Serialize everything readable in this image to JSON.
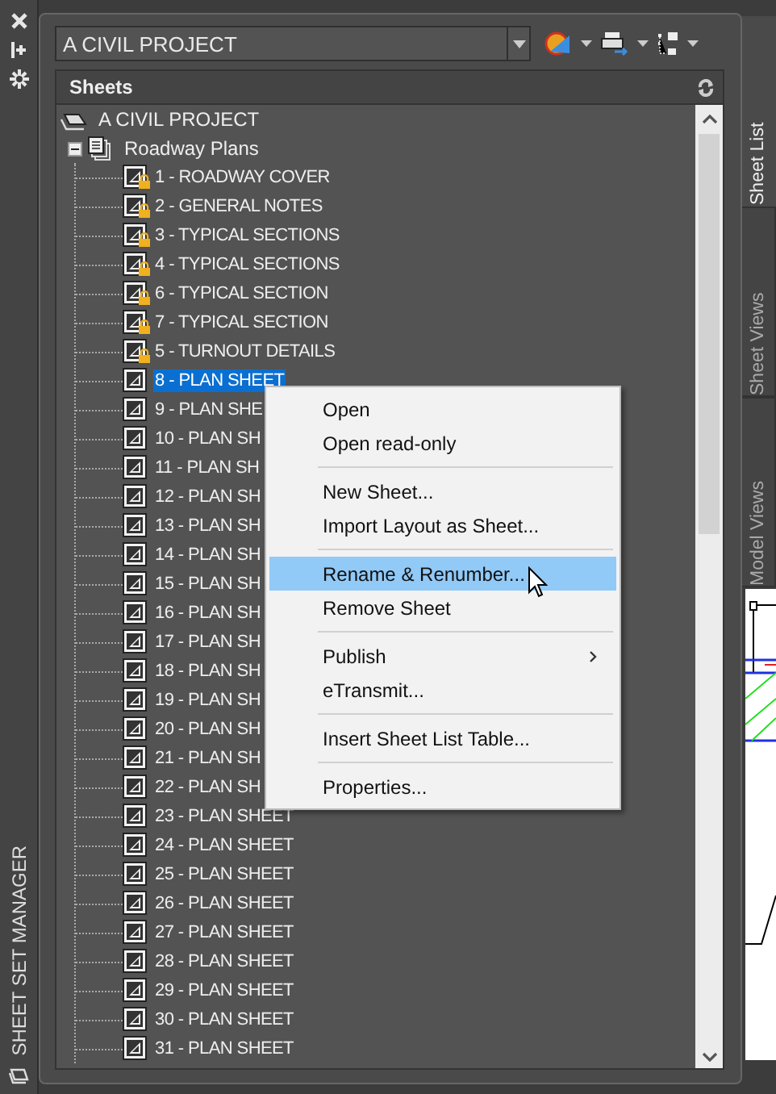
{
  "palette_title": "SHEET SET MANAGER",
  "sheet_set_combo": {
    "value": "A CIVIL PROJECT"
  },
  "panel_title": "Sheets",
  "side_tabs": [
    {
      "label": "Sheet List",
      "selected": true
    },
    {
      "label": "Sheet Views",
      "selected": false
    },
    {
      "label": "Model Views",
      "selected": false
    }
  ],
  "tree": {
    "label": "A CIVIL PROJECT",
    "children": [
      {
        "label": "Roadway Plans",
        "expanded": true,
        "children": [
          {
            "label": "1 - ROADWAY COVER",
            "locked": true,
            "selected": false
          },
          {
            "label": "2 - GENERAL NOTES",
            "locked": true,
            "selected": false
          },
          {
            "label": "3 - TYPICAL SECTIONS",
            "locked": true,
            "selected": false
          },
          {
            "label": "4 - TYPICAL SECTIONS",
            "locked": true,
            "selected": false
          },
          {
            "label": "6 - TYPICAL SECTION",
            "locked": true,
            "selected": false
          },
          {
            "label": "7 - TYPICAL SECTION",
            "locked": true,
            "selected": false
          },
          {
            "label": "5 - TURNOUT DETAILS",
            "locked": true,
            "selected": false
          },
          {
            "label": "8 - PLAN SHEET",
            "locked": false,
            "selected": true
          },
          {
            "label": "9 - PLAN SHE",
            "locked": false,
            "selected": false
          },
          {
            "label": "10 - PLAN SH",
            "locked": false,
            "selected": false
          },
          {
            "label": "11 - PLAN SH",
            "locked": false,
            "selected": false
          },
          {
            "label": "12 - PLAN SH",
            "locked": false,
            "selected": false
          },
          {
            "label": "13 - PLAN SH",
            "locked": false,
            "selected": false
          },
          {
            "label": "14 - PLAN SH",
            "locked": false,
            "selected": false
          },
          {
            "label": "15 - PLAN SH",
            "locked": false,
            "selected": false
          },
          {
            "label": "16 - PLAN SH",
            "locked": false,
            "selected": false
          },
          {
            "label": "17 - PLAN SH",
            "locked": false,
            "selected": false
          },
          {
            "label": "18 - PLAN SH",
            "locked": false,
            "selected": false
          },
          {
            "label": "19 - PLAN SH",
            "locked": false,
            "selected": false
          },
          {
            "label": "20 - PLAN SH",
            "locked": false,
            "selected": false
          },
          {
            "label": "21 - PLAN SH",
            "locked": false,
            "selected": false
          },
          {
            "label": "22 - PLAN SH",
            "locked": false,
            "selected": false
          },
          {
            "label": "23 - PLAN SHEET",
            "locked": false,
            "selected": false
          },
          {
            "label": "24 - PLAN SHEET",
            "locked": false,
            "selected": false
          },
          {
            "label": "25 - PLAN SHEET",
            "locked": false,
            "selected": false
          },
          {
            "label": "26 - PLAN SHEET",
            "locked": false,
            "selected": false
          },
          {
            "label": "27 - PLAN SHEET",
            "locked": false,
            "selected": false
          },
          {
            "label": "28 - PLAN SHEET",
            "locked": false,
            "selected": false
          },
          {
            "label": "29 - PLAN SHEET",
            "locked": false,
            "selected": false
          },
          {
            "label": "30 - PLAN SHEET",
            "locked": false,
            "selected": false
          },
          {
            "label": "31 - PLAN SHEET",
            "locked": false,
            "selected": false
          }
        ]
      }
    ]
  },
  "context_menu": {
    "groups": [
      [
        {
          "label": "Open",
          "selected": false,
          "submenu": false
        },
        {
          "label": "Open read-only",
          "selected": false,
          "submenu": false
        }
      ],
      [
        {
          "label": "New Sheet...",
          "selected": false,
          "submenu": false
        },
        {
          "label": "Import Layout as Sheet...",
          "selected": false,
          "submenu": false
        }
      ],
      [
        {
          "label": "Rename & Renumber...",
          "selected": true,
          "submenu": false
        },
        {
          "label": "Remove Sheet",
          "selected": false,
          "submenu": false
        }
      ],
      [
        {
          "label": "Publish",
          "selected": false,
          "submenu": true
        },
        {
          "label": "eTransmit...",
          "selected": false,
          "submenu": false
        }
      ],
      [
        {
          "label": "Insert Sheet List Table...",
          "selected": false,
          "submenu": false
        }
      ],
      [
        {
          "label": "Properties...",
          "selected": false,
          "submenu": false
        }
      ]
    ]
  }
}
